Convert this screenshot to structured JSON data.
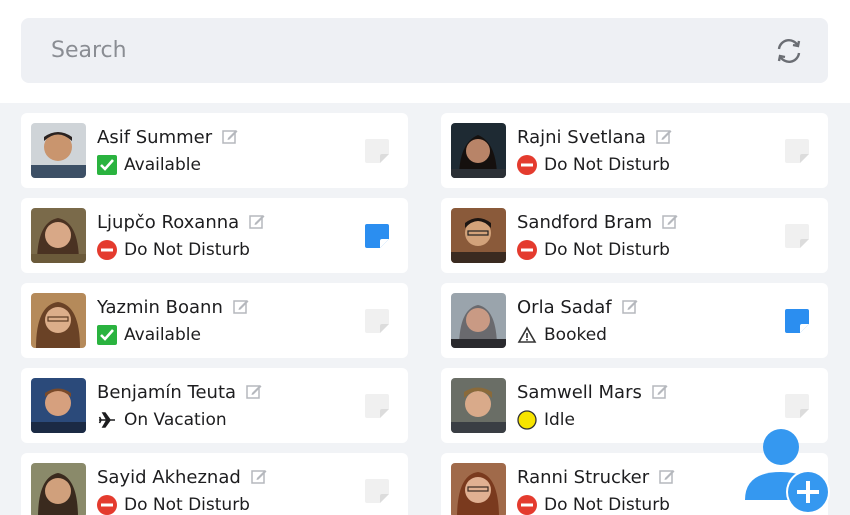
{
  "search": {
    "placeholder": "Search"
  },
  "colors": {
    "available": "#2ab33f",
    "dnd": "#e43b2e",
    "idle": "#f7e400",
    "note_active": "#2b8ef0",
    "note_inactive": "#f0f0f0",
    "fab": "#3598f0"
  },
  "contacts": [
    {
      "name": "Asif Summer",
      "status": "Available",
      "status_icon": "check-icon",
      "note_active": false
    },
    {
      "name": "Rajni Svetlana",
      "status": "Do Not Disturb",
      "status_icon": "do-not-disturb-icon",
      "note_active": false
    },
    {
      "name": "Ljupčo Roxanna",
      "status": "Do Not Disturb",
      "status_icon": "do-not-disturb-icon",
      "note_active": true
    },
    {
      "name": "Sandford Bram",
      "status": "Do Not Disturb",
      "status_icon": "do-not-disturb-icon",
      "note_active": false
    },
    {
      "name": "Yazmin Boann",
      "status": "Available",
      "status_icon": "check-icon",
      "note_active": false
    },
    {
      "name": "Orla Sadaf",
      "status": "Booked",
      "status_icon": "warning-icon",
      "note_active": true
    },
    {
      "name": "Benjamín Teuta",
      "status": "On Vacation",
      "status_icon": "airplane-icon",
      "note_active": false
    },
    {
      "name": "Samwell Mars",
      "status": "Idle",
      "status_icon": "idle-icon",
      "note_active": false
    },
    {
      "name": "Sayid Akheznad",
      "status": "Do Not Disturb",
      "status_icon": "do-not-disturb-icon",
      "note_active": false
    },
    {
      "name": "Ranni Strucker",
      "status": "Do Not Disturb",
      "status_icon": "do-not-disturb-icon",
      "note_active": false
    }
  ]
}
